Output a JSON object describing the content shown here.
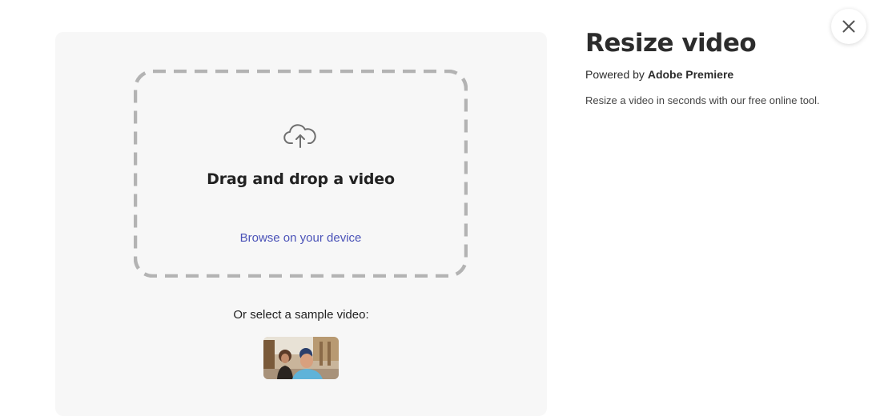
{
  "upload": {
    "drop_title": "Drag and drop a video",
    "browse_label": "Browse on your device",
    "sample_label": "Or select a sample video:",
    "upload_icon": "cloud-upload-icon"
  },
  "side": {
    "title": "Resize video",
    "powered_prefix": "Powered by",
    "powered_brand": "Adobe Premiere",
    "description": "Resize a video in seconds with our free online tool."
  },
  "close": {
    "icon": "close-icon"
  },
  "colors": {
    "panel_bg": "#f7f7f7",
    "dash_border": "#b3b3b3",
    "link": "#4b53b8",
    "text": "#2c2c2c"
  }
}
